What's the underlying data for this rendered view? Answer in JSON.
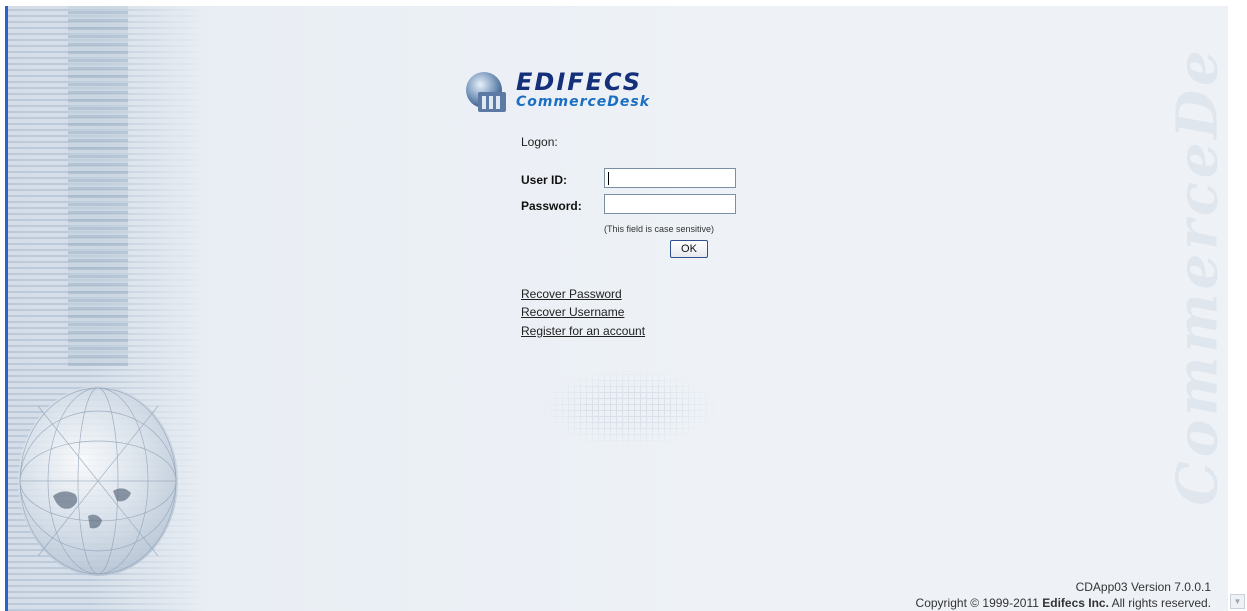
{
  "logo": {
    "brand": "EDIFECS",
    "product": "CommerceDesk"
  },
  "watermark": "CommerceDe",
  "form": {
    "heading": "Logon:",
    "user_id_label": "User ID:",
    "user_id_value": "",
    "password_label": "Password:",
    "password_value": "",
    "password_hint": "(This field is case sensitive)",
    "ok_label": "OK"
  },
  "links": {
    "recover_password": "Recover Password",
    "recover_username": "Recover Username",
    "register": "Register for an account"
  },
  "footer": {
    "version": "CDApp03 Version 7.0.0.1",
    "copyright_prefix": "Copyright © 1999-2011 ",
    "company": "Edifecs Inc.",
    "copyright_suffix": " All rights reserved."
  },
  "icons": {
    "scroll_down": "chevron-down-icon",
    "logo": "edifecs-logo-icon"
  }
}
